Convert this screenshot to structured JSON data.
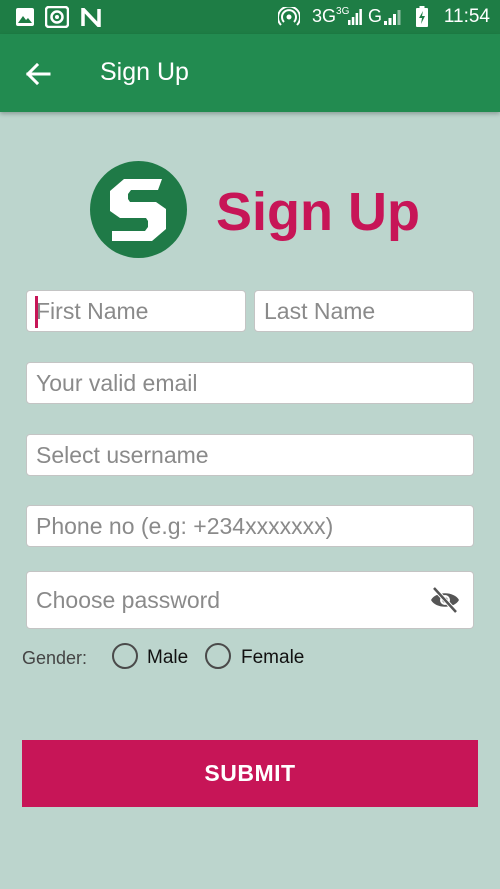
{
  "status_bar": {
    "time": "11:54",
    "network_label": "3G",
    "network_sup": "3G",
    "network_label_2": "G",
    "icons": [
      "image-icon",
      "record-icon",
      "n-app-icon",
      "hotspot-icon",
      "signal-icon",
      "signal-icon-2",
      "battery-charging-icon"
    ]
  },
  "app_bar": {
    "title": "Sign Up",
    "back_icon": "arrow-back-icon"
  },
  "brand": {
    "logo_letter": "S",
    "heading": "Sign Up",
    "logo_color": "#1f7a47",
    "heading_color": "#c71557"
  },
  "form": {
    "first_name": {
      "placeholder": "First Name",
      "value": ""
    },
    "last_name": {
      "placeholder": "Last Name",
      "value": ""
    },
    "email": {
      "placeholder": "Your valid email",
      "value": ""
    },
    "username": {
      "placeholder": "Select username",
      "value": ""
    },
    "phone": {
      "placeholder": "Phone no (e.g: +234xxxxxxx)",
      "value": ""
    },
    "password": {
      "placeholder": "Choose password",
      "value": "",
      "toggle_icon": "visibility-off-icon"
    },
    "gender": {
      "label": "Gender:",
      "options": [
        "Male",
        "Female"
      ],
      "selected": null
    },
    "submit_label": "SUBMIT"
  },
  "colors": {
    "background": "#bcd5cd",
    "app_bar": "#228b50",
    "status_bar": "#1e7d45",
    "accent": "#c71557"
  }
}
